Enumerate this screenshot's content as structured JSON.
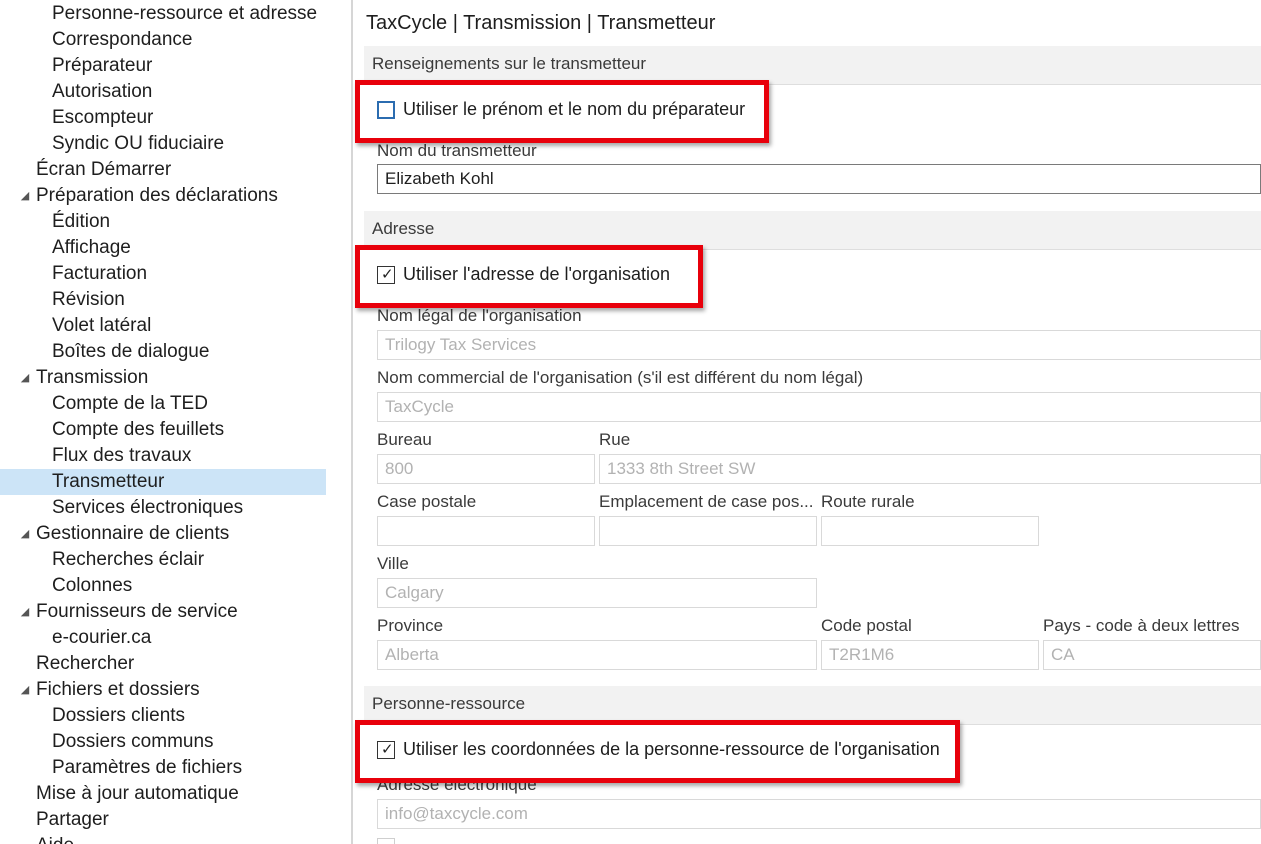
{
  "sidebar": {
    "items": [
      {
        "label": "Personne-ressource et adresse",
        "level": 2,
        "selected": false,
        "expander": ""
      },
      {
        "label": "Correspondance",
        "level": 2,
        "selected": false,
        "expander": ""
      },
      {
        "label": "Préparateur",
        "level": 2,
        "selected": false,
        "expander": ""
      },
      {
        "label": "Autorisation",
        "level": 2,
        "selected": false,
        "expander": ""
      },
      {
        "label": "Escompteur",
        "level": 2,
        "selected": false,
        "expander": ""
      },
      {
        "label": "Syndic OU fiduciaire",
        "level": 2,
        "selected": false,
        "expander": ""
      },
      {
        "label": "Écran Démarrer",
        "level": 1,
        "selected": false,
        "expander": ""
      },
      {
        "label": "Préparation des déclarations",
        "level": 1,
        "selected": false,
        "expander": "◢"
      },
      {
        "label": "Édition",
        "level": 2,
        "selected": false,
        "expander": ""
      },
      {
        "label": "Affichage",
        "level": 2,
        "selected": false,
        "expander": ""
      },
      {
        "label": "Facturation",
        "level": 2,
        "selected": false,
        "expander": ""
      },
      {
        "label": "Révision",
        "level": 2,
        "selected": false,
        "expander": ""
      },
      {
        "label": "Volet latéral",
        "level": 2,
        "selected": false,
        "expander": ""
      },
      {
        "label": "Boîtes de dialogue",
        "level": 2,
        "selected": false,
        "expander": ""
      },
      {
        "label": "Transmission",
        "level": 1,
        "selected": false,
        "expander": "◢"
      },
      {
        "label": "Compte de la TED",
        "level": 2,
        "selected": false,
        "expander": ""
      },
      {
        "label": "Compte des feuillets",
        "level": 2,
        "selected": false,
        "expander": ""
      },
      {
        "label": "Flux des travaux",
        "level": 2,
        "selected": false,
        "expander": ""
      },
      {
        "label": "Transmetteur",
        "level": 2,
        "selected": true,
        "expander": ""
      },
      {
        "label": "Services électroniques",
        "level": 2,
        "selected": false,
        "expander": ""
      },
      {
        "label": "Gestionnaire de clients",
        "level": 1,
        "selected": false,
        "expander": "◢"
      },
      {
        "label": "Recherches éclair",
        "level": 2,
        "selected": false,
        "expander": ""
      },
      {
        "label": "Colonnes",
        "level": 2,
        "selected": false,
        "expander": ""
      },
      {
        "label": "Fournisseurs de service",
        "level": 1,
        "selected": false,
        "expander": "◢"
      },
      {
        "label": "e-courier.ca",
        "level": 2,
        "selected": false,
        "expander": ""
      },
      {
        "label": "Rechercher",
        "level": 1,
        "selected": false,
        "expander": ""
      },
      {
        "label": "Fichiers et dossiers",
        "level": 1,
        "selected": false,
        "expander": "◢"
      },
      {
        "label": "Dossiers clients",
        "level": 2,
        "selected": false,
        "expander": ""
      },
      {
        "label": "Dossiers communs",
        "level": 2,
        "selected": false,
        "expander": ""
      },
      {
        "label": "Paramètres de fichiers",
        "level": 2,
        "selected": false,
        "expander": ""
      },
      {
        "label": "Mise à jour automatique",
        "level": 1,
        "selected": false,
        "expander": ""
      },
      {
        "label": "Partager",
        "level": 1,
        "selected": false,
        "expander": ""
      },
      {
        "label": "Aide",
        "level": 1,
        "selected": false,
        "expander": ""
      }
    ]
  },
  "main": {
    "title": "TaxCycle | Transmission | Transmetteur",
    "sections": {
      "transmitter": {
        "header": "Renseignements sur le transmetteur",
        "use_preparer_checkbox": {
          "label": "Utiliser le prénom et le nom du préparateur",
          "checked": false
        },
        "name_label": "Nom du transmetteur",
        "name_value": "Elizabeth Kohl"
      },
      "address": {
        "header": "Adresse",
        "use_org_address_checkbox": {
          "label": "Utiliser l'adresse de l'organisation",
          "checked": true
        },
        "legal_name_label": "Nom légal de l'organisation",
        "legal_name_value": "Trilogy Tax Services",
        "trade_name_label": "Nom commercial de l'organisation (s'il est différent du nom légal)",
        "trade_name_value": "TaxCycle",
        "office_label": "Bureau",
        "office_value": "800",
        "street_label": "Rue",
        "street_value": "1333 8th Street SW",
        "po_box_label": "Case postale",
        "po_box_value": "",
        "po_box_location_label": "Emplacement de case pos...",
        "po_box_location_value": "",
        "rural_route_label": "Route rurale",
        "rural_route_value": "",
        "city_label": "Ville",
        "city_value": "Calgary",
        "province_label": "Province",
        "province_value": "Alberta",
        "postal_code_label": "Code postal",
        "postal_code_value": "T2R1M6",
        "country_label": "Pays - code à deux lettres",
        "country_value": "CA"
      },
      "contact": {
        "header": "Personne-ressource",
        "use_org_contact_checkbox": {
          "label": "Utiliser les coordonnées de la personne-ressource de l'organisation",
          "checked": true
        },
        "email_label": "Adresse électronique",
        "email_value": "info@taxcycle.com"
      }
    }
  },
  "colors": {
    "highlight": "#e8000b",
    "selection": "#cce4f7",
    "section_bg": "#f2f2f2"
  }
}
